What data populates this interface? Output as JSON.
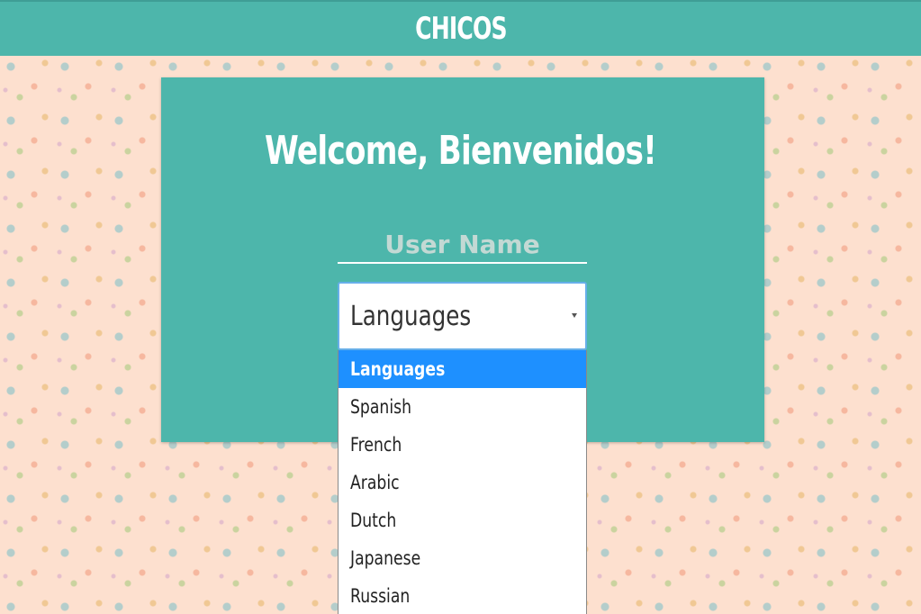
{
  "header": {
    "title": "CHICOS"
  },
  "main": {
    "welcome": "Welcome, Bienvenidos!",
    "username_placeholder": "User Name",
    "username_value": "",
    "language_select": {
      "selected": "Languages",
      "options": [
        "Languages",
        "Spanish",
        "French",
        "Arabic",
        "Dutch",
        "Japanese",
        "Russian"
      ]
    }
  },
  "colors": {
    "accent": "#4db6ab",
    "background": "#fde0cf",
    "selected_option": "#1e90ff"
  }
}
